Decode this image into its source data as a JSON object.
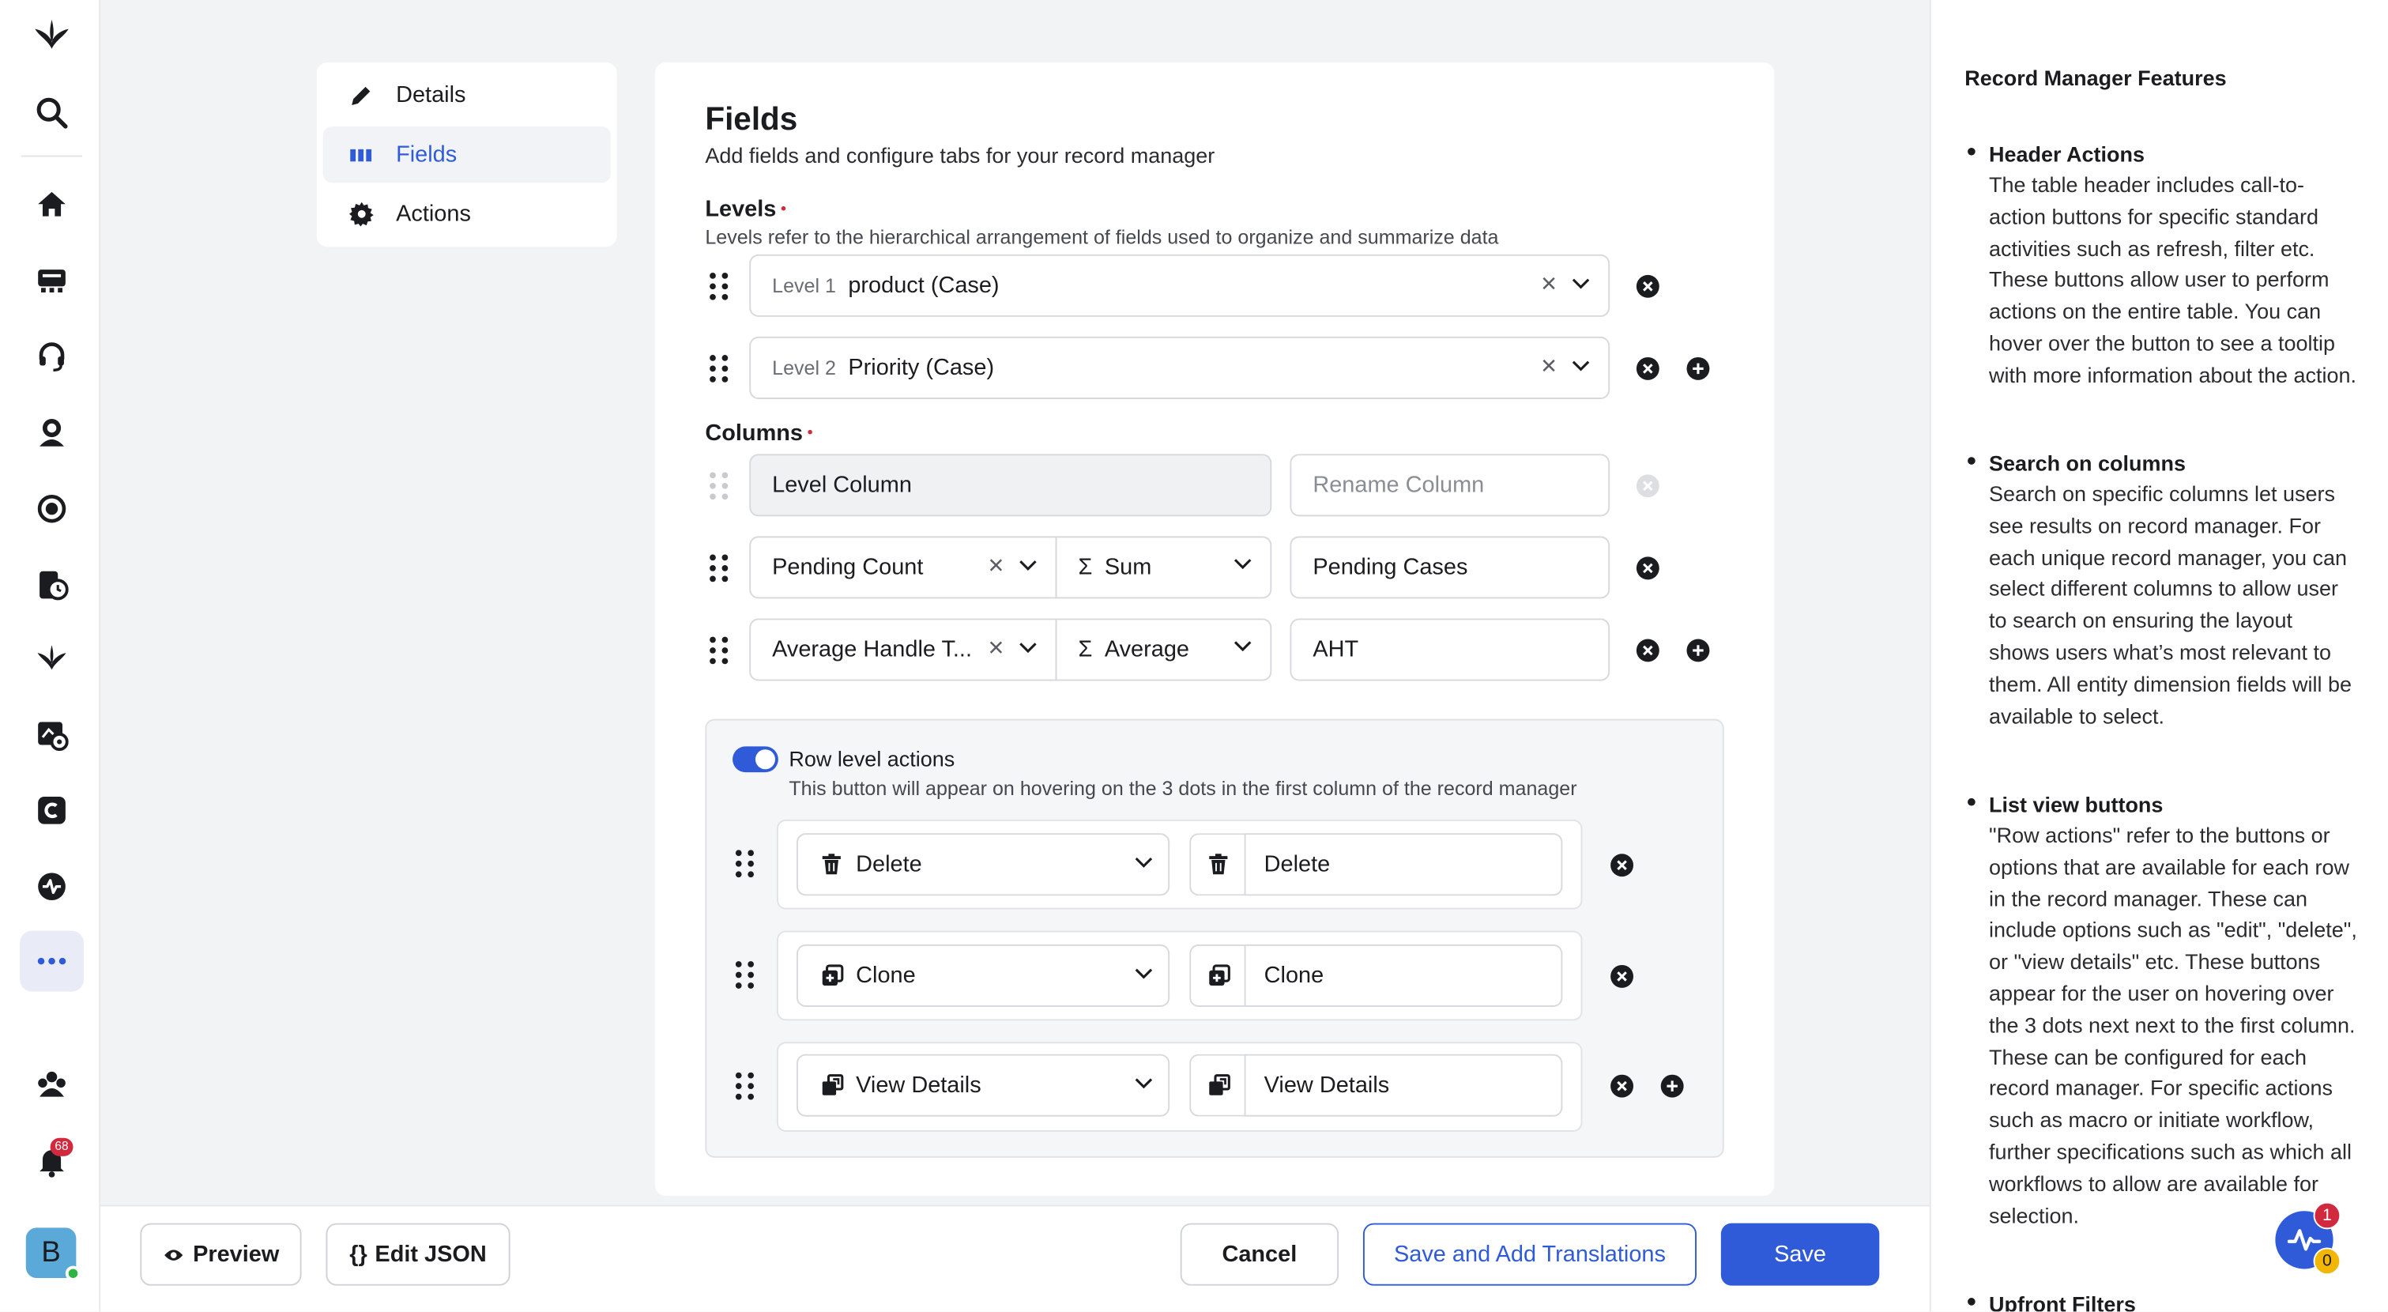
{
  "nav": {
    "items": [
      {
        "label": "Details",
        "icon": "pencil-icon"
      },
      {
        "label": "Fields",
        "icon": "columns-icon",
        "active": true
      },
      {
        "label": "Actions",
        "icon": "gear-icon"
      }
    ]
  },
  "rail": {
    "notification_count": "68",
    "avatar_initial": "B"
  },
  "fields": {
    "title": "Fields",
    "subtitle": "Add fields and configure tabs for your record manager",
    "levels": {
      "title": "Levels",
      "description": "Levels refer to the hierarchical arrangement of fields used to organize and summarize data",
      "rows": [
        {
          "prefix": "Level 1",
          "value": "product (Case)"
        },
        {
          "prefix": "Level 2",
          "value": "Priority (Case)"
        }
      ]
    },
    "columns": {
      "title": "Columns",
      "level_column": "Level Column",
      "rename_placeholder": "Rename Column",
      "rows": [
        {
          "field": "Pending Count",
          "aggregate": "Sum",
          "aggregate_icon": "Σ",
          "rename": "Pending Cases"
        },
        {
          "field": "Average Handle T...",
          "aggregate": "Average",
          "aggregate_icon": "Σ",
          "rename": "AHT"
        }
      ]
    },
    "row_actions": {
      "title": "Row level actions",
      "description": "This button will appear on hovering on the 3 dots in the first column of the record manager",
      "enabled": true,
      "rows": [
        {
          "action": "Delete",
          "icon": "trash-icon",
          "label": "Delete"
        },
        {
          "action": "Clone",
          "icon": "clone-icon",
          "label": "Clone"
        },
        {
          "action": "View Details",
          "icon": "view-details-icon",
          "label": "View Details"
        }
      ]
    }
  },
  "footer": {
    "preview": "Preview",
    "edit_json": "Edit JSON",
    "edit_json_icon": "{}",
    "cancel": "Cancel",
    "save_translations": "Save and Add Translations",
    "save": "Save"
  },
  "panel": {
    "title": "Record Manager Features",
    "features": [
      {
        "title": "Header Actions",
        "text": "The table header includes call-to-action buttons for specific standard activities such as refresh, filter etc. These buttons allow user to perform actions on the entire table. You can hover over the button to see a tooltip with more information about the action."
      },
      {
        "title": "Search on columns",
        "text": "Search on specific columns let users see results on record manager. For each unique record manager, you can select different columns to allow user to search on ensuring the layout shows users what’s most relevant to them. All entity dimension fields will be available to select."
      },
      {
        "title": "List view buttons",
        "text": "\"Row actions\" refer to the buttons or options that are available for each row in the record manager. These can include options such as \"edit\", \"delete\", or \"view details\" etc. These buttons appear for the user on hovering over the 3 dots next next to the first column. These can be configured for each record manager. For specific actions such as macro or initiate workflow, further specifications such as which all workflows to allow are available for selection."
      },
      {
        "title": "Upfront Filters",
        "text": ""
      }
    ],
    "fab_badge_red": "1",
    "fab_badge_yellow": "0"
  },
  "colors": {
    "accent": "#2f5bd8",
    "danger": "#d1293d"
  }
}
